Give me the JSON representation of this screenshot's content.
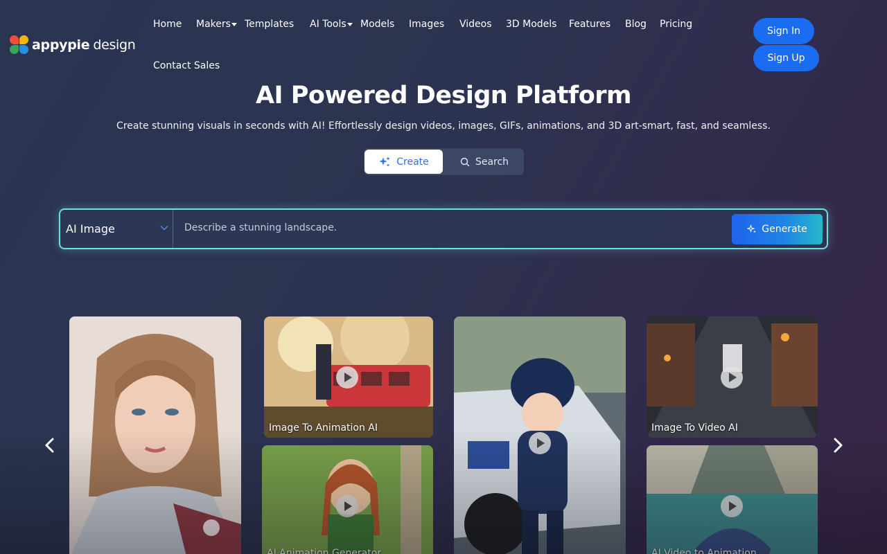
{
  "brand": {
    "name_bold": "appypie",
    "name_light": "design",
    "colors": [
      "#ef4e3a",
      "#f8b500",
      "#3aa35a",
      "#2a8fe3"
    ]
  },
  "nav": {
    "items": [
      {
        "label": "Home",
        "dropdown": false
      },
      {
        "label": "Makers",
        "dropdown": true
      },
      {
        "label": "Templates",
        "dropdown": false
      },
      {
        "label": "AI Tools",
        "dropdown": true
      },
      {
        "label": "Models",
        "dropdown": false
      },
      {
        "label": "Images",
        "dropdown": false
      },
      {
        "label": "Videos",
        "dropdown": false
      },
      {
        "label": "3D Models",
        "dropdown": false
      },
      {
        "label": "Features",
        "dropdown": false
      },
      {
        "label": "Blog",
        "dropdown": false
      },
      {
        "label": "Pricing",
        "dropdown": false
      },
      {
        "label": "Contact Sales",
        "dropdown": false
      }
    ]
  },
  "auth": {
    "sign_in": "Sign In",
    "sign_up": "Sign Up",
    "accent": "#1a6cf0"
  },
  "hero": {
    "title": "AI Powered Design Platform",
    "subtitle": "Create stunning visuals in seconds with AI! Effortlessly design videos, images, GIFs, animations, and 3D art-smart, fast, and seamless."
  },
  "mode_toggle": {
    "create_label": "Create",
    "search_label": "Search",
    "active": "Create"
  },
  "generator": {
    "type_selected": "AI Image",
    "prompt_placeholder": "Describe a stunning landscape.",
    "prompt_value": "",
    "generate_label": "Generate",
    "border_color": "#6fe0e0"
  },
  "gallery": {
    "cards": [
      {
        "label": "",
        "video": false,
        "subject": "portrait of a woman in kimono"
      },
      {
        "label": "Image To Animation AI",
        "video": true,
        "subject": "anime train scene"
      },
      {
        "label": "AI Animation Generator",
        "video": true,
        "subject": "anime girl with braid"
      },
      {
        "label": "",
        "video": true,
        "subject": "child in police armor"
      },
      {
        "label": "Image To Video AI",
        "video": true,
        "subject": "city street at night"
      },
      {
        "label": "AI Video to Animation",
        "video": true,
        "subject": "boat on river in canyon"
      }
    ],
    "prev_icon": "chevron-left-icon",
    "next_icon": "chevron-right-icon"
  }
}
